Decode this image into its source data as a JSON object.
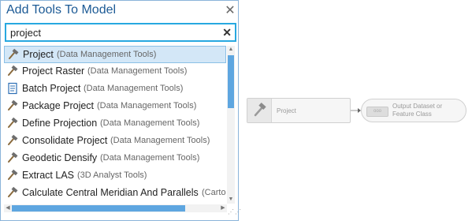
{
  "panel": {
    "title": "Add Tools To Model",
    "close_glyph": "✕",
    "search": {
      "value": "project",
      "clear_glyph": "✕"
    }
  },
  "results": [
    {
      "name": "Project",
      "toolbox": "(Data Management Tools)",
      "icon": "hammer-icon",
      "selected": true
    },
    {
      "name": "Project Raster",
      "toolbox": "(Data Management Tools)",
      "icon": "hammer-icon"
    },
    {
      "name": "Batch Project",
      "toolbox": "(Data Management Tools)",
      "icon": "script-icon"
    },
    {
      "name": "Package Project",
      "toolbox": "(Data Management Tools)",
      "icon": "hammer-icon"
    },
    {
      "name": "Define Projection",
      "toolbox": "(Data Management Tools)",
      "icon": "hammer-icon"
    },
    {
      "name": "Consolidate Project",
      "toolbox": "(Data Management Tools)",
      "icon": "hammer-icon"
    },
    {
      "name": "Geodetic Densify",
      "toolbox": "(Data Management Tools)",
      "icon": "hammer-icon"
    },
    {
      "name": "Extract LAS",
      "toolbox": "(3D Analyst Tools)",
      "icon": "hammer-icon"
    },
    {
      "name": "Calculate Central Meridian And Parallels",
      "toolbox": "(Cartogra",
      "icon": "hammer-icon"
    }
  ],
  "canvas": {
    "tool_node_label": "Project",
    "output_node_label": "Output Dataset or Feature Class",
    "output_badge": "ooo"
  },
  "colors": {
    "title": "#1c5a95",
    "search_border": "#28a8e0",
    "selection": "#d3e7f7",
    "scrollbar_thumb": "#5ea6e0"
  }
}
